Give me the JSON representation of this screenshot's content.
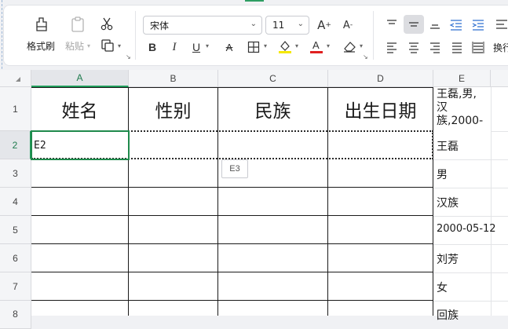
{
  "toolbar": {
    "format_painter_label": "格式刷",
    "paste_label": "粘贴",
    "font_name": "宋体",
    "font_size": "11",
    "wrap_label": "换行",
    "font_color": "#e02020",
    "highlight_color": "#f5e800"
  },
  "grid": {
    "columns": [
      "A",
      "B",
      "C",
      "D",
      "E"
    ],
    "rows": [
      "1",
      "2",
      "3",
      "4",
      "5",
      "6",
      "7",
      "8"
    ],
    "active_column": "A",
    "active_row": "2",
    "header_cells": [
      "姓名",
      "性别",
      "民族",
      "出生日期"
    ],
    "e1_lines": [
      "王磊,男,",
      "汉",
      "族,2000-"
    ],
    "a2_value": "E2",
    "tooltip": "E3",
    "e_values": [
      "王磊",
      "男",
      "汉族",
      "2000-05-12",
      "刘芳",
      "女",
      "回族"
    ]
  }
}
